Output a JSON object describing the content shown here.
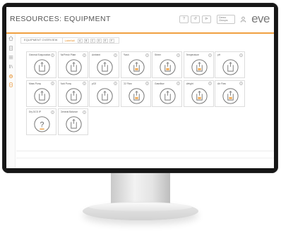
{
  "app": {
    "title": "RESOURCES: EQUIPMENT",
    "header_buttons": [
      "?",
      "↺",
      "⊳"
    ],
    "select_text": "Demo\nGroups",
    "logo": "eve",
    "accent_color": "#f0a040"
  },
  "sidebar": {
    "icons": [
      "home-icon",
      "document-icon",
      "list-icon",
      "library-icon",
      "settings-icon",
      "resource-icon"
    ]
  },
  "breadcrumb": {
    "main": "EQUIPMENT OVERVIEW",
    "filter_label": "Label/all",
    "letters": [
      "A",
      "B",
      "C",
      "D",
      "E",
      "F"
    ]
  },
  "equipment": [
    {
      "label": "General Evaporation",
      "state": "gray"
    },
    {
      "label": "Air/Fresh Plate",
      "state": "gray"
    },
    {
      "label": "Ambient",
      "state": "gray"
    },
    {
      "label": "Flash",
      "state": "orange"
    },
    {
      "label": "Stirrer",
      "state": "orange"
    },
    {
      "label": "Temperature",
      "state": "orange"
    },
    {
      "label": "pH",
      "state": "gray"
    },
    {
      "label": "Mass Pump",
      "state": "gray"
    },
    {
      "label": "Acid Pump",
      "state": "gray"
    },
    {
      "label": "pO2",
      "state": "gray"
    },
    {
      "label": "O2 Flow",
      "state": "orange"
    },
    {
      "label": "Gassflow",
      "state": "gray"
    },
    {
      "label": "Weight",
      "state": "orange"
    },
    {
      "label": "Air Flow",
      "state": "orange"
    },
    {
      "label": "Dry DCS IP",
      "state": "unknown"
    },
    {
      "label": "General Balance",
      "state": "gray"
    }
  ]
}
